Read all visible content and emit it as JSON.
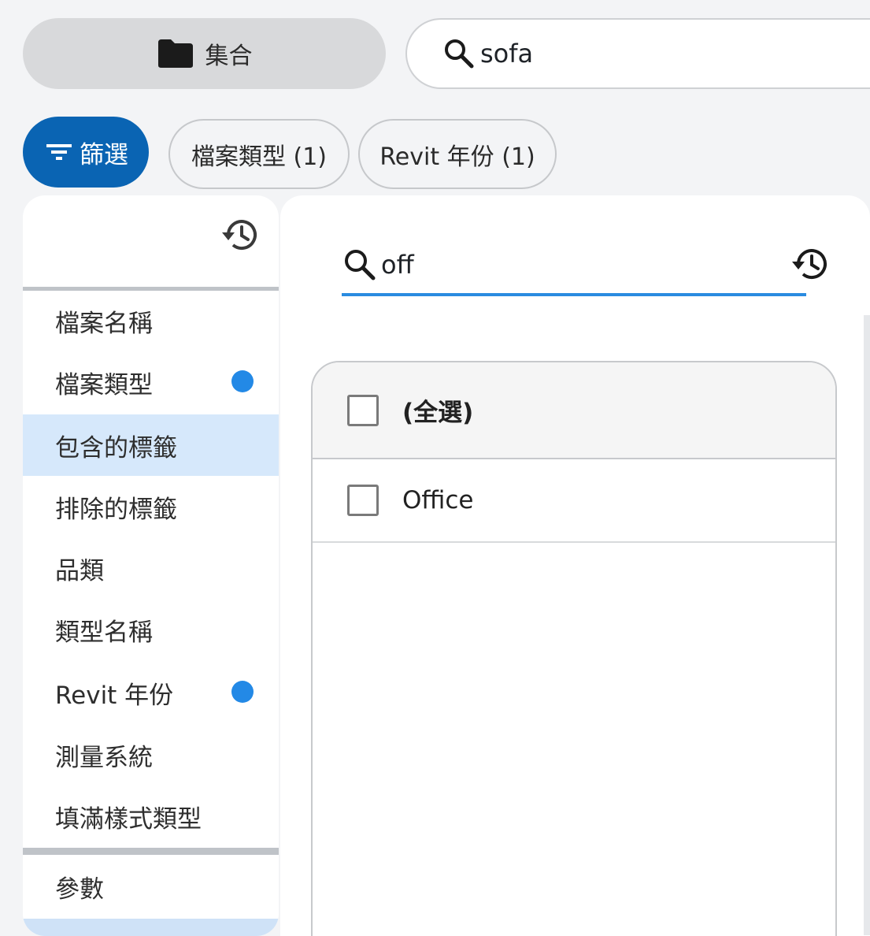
{
  "topbar": {
    "collection_label": "集合",
    "search_value": "sofa"
  },
  "chips": {
    "filter_label": "篩選",
    "file_type": "檔案類型 (1)",
    "revit_year": "Revit 年份 (1)"
  },
  "categories": [
    {
      "label": "檔案名稱",
      "has_dot": false
    },
    {
      "label": "檔案類型",
      "has_dot": true
    },
    {
      "label": "包含的標籤",
      "has_dot": false,
      "active": true
    },
    {
      "label": "排除的標籤",
      "has_dot": false
    },
    {
      "label": "品類",
      "has_dot": false
    },
    {
      "label": "類型名稱",
      "has_dot": false
    },
    {
      "label": "Revit 年份",
      "has_dot": true
    },
    {
      "label": "測量系統",
      "has_dot": false
    },
    {
      "label": "填滿樣式類型",
      "has_dot": false
    }
  ],
  "params_label": "參數",
  "value_search": {
    "value": "off"
  },
  "values_list": {
    "select_all_label": "(全選)",
    "items": [
      "Office"
    ]
  },
  "colors": {
    "primary": "#0a64b3",
    "accent": "#2a8be0",
    "active_bg": "#d6e8fb",
    "dot": "#2389e6"
  },
  "icons": {
    "collection": "folder-icon",
    "search": "search-icon",
    "filter": "filter-icon",
    "history": "history-icon"
  }
}
